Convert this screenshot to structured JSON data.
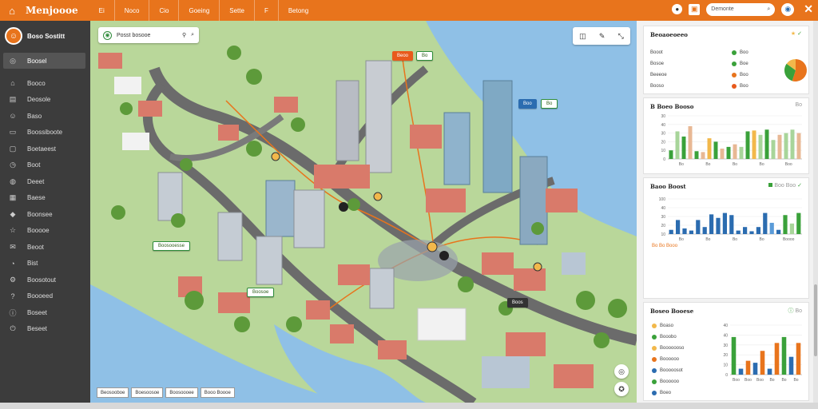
{
  "app": {
    "title": "Menjoooe",
    "nav": [
      "Ei",
      "Noco",
      "Cio",
      "Goeing",
      "Sette",
      "F",
      "Betong"
    ],
    "search_placeholder": "Demonte",
    "colors": {
      "accent": "#e8741c",
      "sidebar": "#3c3c3c",
      "map_water": "#8fc0e6"
    }
  },
  "sidebar": {
    "username": "Boso Sostitt",
    "active_item": "Boosel",
    "items": [
      {
        "icon": "home-icon",
        "label": "Booco"
      },
      {
        "icon": "chart-icon",
        "label": "Deosole"
      },
      {
        "icon": "people-icon",
        "label": "Baso"
      },
      {
        "icon": "document-icon",
        "label": "Boossiboote"
      },
      {
        "icon": "folder-icon",
        "label": "Boetaeest"
      },
      {
        "icon": "clock-icon",
        "label": "Boot"
      },
      {
        "icon": "pin-icon",
        "label": "Deeet"
      },
      {
        "icon": "calendar-icon",
        "label": "Baese"
      },
      {
        "icon": "tag-icon",
        "label": "Boonsee"
      },
      {
        "icon": "star-icon",
        "label": "Booooe"
      },
      {
        "icon": "mail-icon",
        "label": "Beoot"
      },
      {
        "icon": "bell-icon",
        "label": "Bist"
      },
      {
        "icon": "settings-icon",
        "label": "Boosotout"
      },
      {
        "icon": "help-icon",
        "label": "Boooeed"
      },
      {
        "icon": "info-icon",
        "label": "Boseet"
      },
      {
        "icon": "logout-icon",
        "label": "Beseet"
      }
    ]
  },
  "map": {
    "search_text": "Posst bosooe",
    "labels": [
      {
        "text": "Boosooesse",
        "style": "white"
      },
      {
        "text": "Boosoe",
        "style": "white"
      },
      {
        "text": "Beoo",
        "style": "orange"
      },
      {
        "text": "Bo",
        "style": "white"
      },
      {
        "text": "Boo",
        "style": "blue"
      },
      {
        "text": "Bo",
        "style": "white"
      },
      {
        "text": "Boos",
        "style": "dark"
      }
    ],
    "bottom_tags": [
      "Beosooboe",
      "Boesoosoe",
      "Boosoooee",
      "Booo Boooe"
    ]
  },
  "panel": {
    "stats": {
      "title": "Beoaoeoeeo",
      "rows": [
        {
          "label": "Booot",
          "value": "Boo",
          "color": "#3aa13a"
        },
        {
          "label": "Bosoe",
          "value": "Boe",
          "color": "#3aa13a"
        },
        {
          "label": "Beeeoe",
          "value": "Boo",
          "color": "#e8741c"
        },
        {
          "label": "Booso",
          "value": "Boo",
          "color": "#e85a1c"
        }
      ],
      "pie": [
        {
          "value": 55,
          "color": "#e8741c"
        },
        {
          "value": 30,
          "color": "#3aa13a"
        },
        {
          "value": 15,
          "color": "#f2b84b"
        }
      ]
    },
    "chart1": {
      "title": "B Boeo Booso",
      "action": "Bo",
      "yticks": [
        "30",
        "40",
        "30",
        "20",
        "10",
        "0"
      ],
      "xticks": [
        "Bo",
        "Bo",
        "Bo",
        "Bo",
        "Boo"
      ]
    },
    "chart2": {
      "title": "Baoo Boost",
      "legend": "Boo Boo",
      "yticks": [
        "100",
        "40",
        "30",
        "20",
        "10"
      ],
      "xticks": [
        "Bo",
        "Bo",
        "Bo",
        "Bo",
        "Boooo"
      ],
      "footnote": "Bo Bo Booo"
    },
    "chart3": {
      "title": "Boseo Booese",
      "action": "Bo",
      "legend": [
        {
          "label": "Boaso",
          "color": "#f2b84b"
        },
        {
          "label": "Booobo",
          "color": "#3aa13a"
        },
        {
          "label": "Booooooso",
          "color": "#f2b84b"
        },
        {
          "label": "Boooooo",
          "color": "#e8741c"
        },
        {
          "label": "Booooosot",
          "color": "#2b6cb0"
        },
        {
          "label": "Boooooo",
          "color": "#3aa13a"
        },
        {
          "label": "Boeo",
          "color": "#2b6cb0"
        }
      ],
      "yticks": [
        "40",
        "40",
        "30",
        "20",
        "10",
        "0"
      ],
      "xticks": [
        "Boo",
        "Boo",
        "Boo",
        "Bo",
        "Bo",
        "Bo"
      ]
    }
  },
  "chart_data": [
    {
      "type": "bar",
      "title": "B Boeo Booso",
      "categories": [
        "Bo",
        "Bo",
        "Bo",
        "Bo",
        "Boo"
      ],
      "ylim": [
        0,
        50
      ],
      "grid": true,
      "series": [
        {
          "values": [
            10,
            32,
            26,
            38,
            9,
            8,
            24,
            20,
            12,
            14,
            17,
            14,
            32,
            33,
            28,
            34,
            22,
            28,
            30,
            34,
            30
          ],
          "colors": [
            "#3aa13a",
            "#a8d59a",
            "#3aa13a",
            "#e8b894",
            "#3aa13a",
            "#e8b894",
            "#f2b84b",
            "#3aa13a",
            "#e8b894",
            "#3aa13a",
            "#e8b894",
            "#a8d59a",
            "#3aa13a",
            "#f2b84b",
            "#a8d59a",
            "#3aa13a",
            "#a8d59a",
            "#e8b894",
            "#a8d59a",
            "#a8d59a",
            "#e8b894"
          ]
        }
      ]
    },
    {
      "type": "bar",
      "title": "Baoo Boost",
      "categories": [
        "Bo",
        "Bo",
        "Bo",
        "Bo",
        "Boooo"
      ],
      "ylim": [
        0,
        100
      ],
      "grid": true,
      "series": [
        {
          "values": [
            12,
            40,
            16,
            10,
            40,
            20,
            56,
            46,
            60,
            54,
            10,
            20,
            8,
            20,
            60,
            32,
            12,
            54,
            30,
            60
          ],
          "colors": [
            "#2b6cb0",
            "#2b6cb0",
            "#2b6cb0",
            "#2b6cb0",
            "#2b6cb0",
            "#2b6cb0",
            "#2b6cb0",
            "#2b6cb0",
            "#2b6cb0",
            "#2b6cb0",
            "#2b6cb0",
            "#2b6cb0",
            "#2b6cb0",
            "#2b6cb0",
            "#2b6cb0",
            "#5a9bd8",
            "#2b6cb0",
            "#3aa13a",
            "#a8d59a",
            "#3aa13a"
          ]
        }
      ]
    },
    {
      "type": "bar",
      "title": "Boseo Booese",
      "categories": [
        "Boo",
        "Boo",
        "Boo",
        "Bo",
        "Bo",
        "Bo"
      ],
      "ylim": [
        0,
        50
      ],
      "grid": true,
      "series": [
        {
          "values": [
            38,
            6,
            14,
            12,
            24,
            6,
            32,
            38,
            18,
            32
          ],
          "colors": [
            "#3aa13a",
            "#2b6cb0",
            "#e8741c",
            "#2b6cb0",
            "#e8741c",
            "#2b6cb0",
            "#e8741c",
            "#3aa13a",
            "#2b6cb0",
            "#e8741c"
          ]
        }
      ]
    }
  ]
}
